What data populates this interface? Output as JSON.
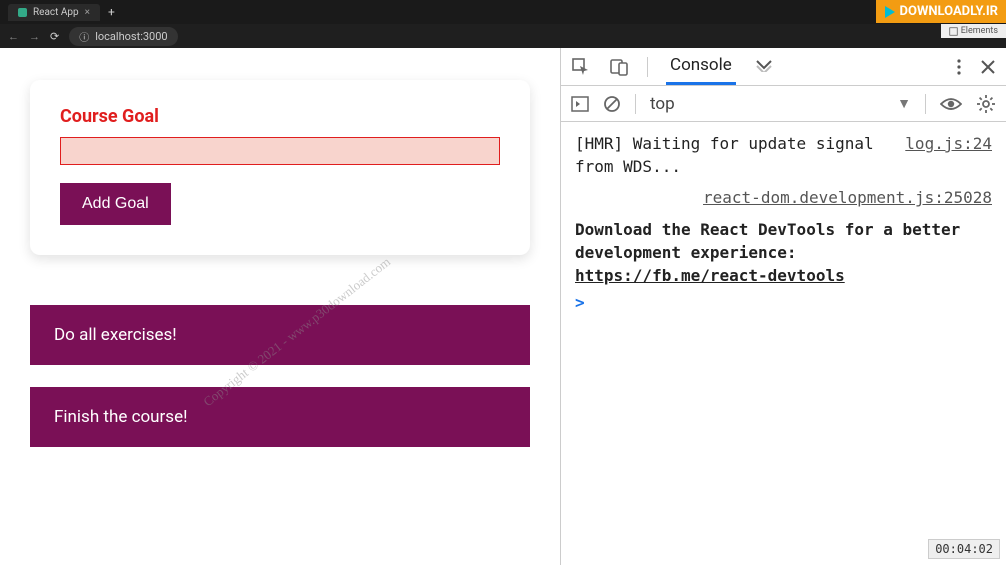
{
  "browser": {
    "tab_title": "React App",
    "address": "localhost:3000"
  },
  "form": {
    "label": "Course Goal",
    "input_value": "",
    "button": "Add Goal"
  },
  "goals": [
    "Do all exercises!",
    "Finish the course!"
  ],
  "watermark": "Copyright © 2021 - www.p30download.com",
  "corner_badge": "DOWNLOADLY.IR",
  "corner_small": "Elements",
  "devtools": {
    "tab_active": "Console",
    "context": "top",
    "log1_msg": "[HMR] Waiting for update signal from WDS...",
    "log1_src": "log.js:24",
    "log2_src": "react-dom.development.js:25028",
    "log2_msg_a": "Download the React DevTools for a better development experience: ",
    "log2_link": "https://fb.me/react-devtools"
  },
  "timestamp": "00:04:02"
}
